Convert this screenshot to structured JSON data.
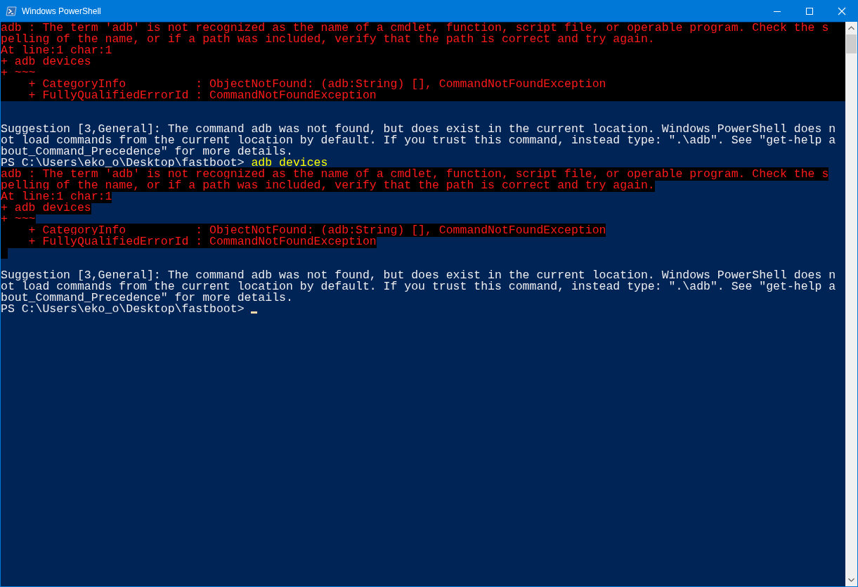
{
  "window": {
    "title": "Windows PowerShell"
  },
  "console": {
    "lines": [
      {
        "kind": "error_wide",
        "text": "adb : The term 'adb' is not recognized as the name of a cmdlet, function, script file, or operable program. Check the s"
      },
      {
        "kind": "error_wide",
        "text": "pelling of the name, or if a path was included, verify that the path is correct and try again."
      },
      {
        "kind": "error_wide",
        "text": "At line:1 char:1"
      },
      {
        "kind": "error_wide",
        "text": "+ adb devices"
      },
      {
        "kind": "error_wide",
        "text": "+ ~~~"
      },
      {
        "kind": "error_wide",
        "text": "    + CategoryInfo          : ObjectNotFound: (adb:String) [], CommandNotFoundException"
      },
      {
        "kind": "error_wide",
        "text": "    + FullyQualifiedErrorId : CommandNotFoundException"
      },
      {
        "kind": "blank"
      },
      {
        "kind": "blank"
      },
      {
        "kind": "text",
        "text": "Suggestion [3,General]: The command adb was not found, but does exist in the current location. Windows PowerShell does n"
      },
      {
        "kind": "text",
        "text": "ot load commands from the current location by default. If you trust this command, instead type: \".\\adb\". See \"get-help a"
      },
      {
        "kind": "text",
        "text": "bout_Command_Precedence\" for more details."
      },
      {
        "kind": "prompt",
        "text": "PS C:\\Users\\eko_o\\Desktop\\fastboot> ",
        "command": "adb devices",
        "cursor": false
      },
      {
        "kind": "error",
        "text": "adb : The term 'adb' is not recognized as the name of a cmdlet, function, script file, or operable program. Check the s"
      },
      {
        "kind": "error",
        "text": "pelling of the name, or if a path was included, verify that the path is correct and try again."
      },
      {
        "kind": "error",
        "text": "At line:1 char:1"
      },
      {
        "kind": "error",
        "text": "+ adb devices"
      },
      {
        "kind": "error",
        "text": "+ ~~~"
      },
      {
        "kind": "error",
        "text": "    + CategoryInfo          : ObjectNotFound: (adb:String) [], CommandNotFoundException"
      },
      {
        "kind": "error",
        "text": "    + FullyQualifiedErrorId : CommandNotFoundException"
      },
      {
        "kind": "error_cell"
      },
      {
        "kind": "blank"
      },
      {
        "kind": "text",
        "text": "Suggestion [3,General]: The command adb was not found, but does exist in the current location. Windows PowerShell does n"
      },
      {
        "kind": "text",
        "text": "ot load commands from the current location by default. If you trust this command, instead type: \".\\adb\". See \"get-help a"
      },
      {
        "kind": "text",
        "text": "bout_Command_Precedence\" for more details."
      },
      {
        "kind": "prompt",
        "text": "PS C:\\Users\\eko_o\\Desktop\\fastboot> ",
        "cursor": true
      }
    ]
  }
}
